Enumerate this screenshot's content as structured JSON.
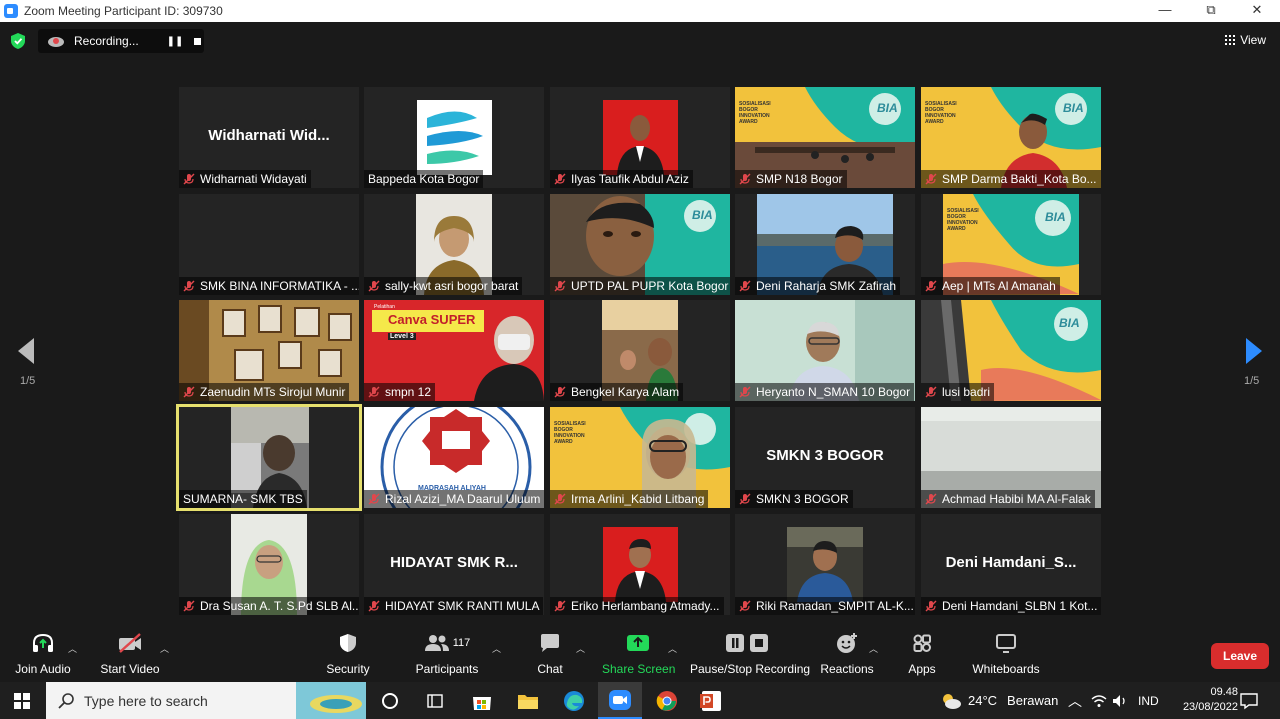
{
  "window": {
    "title": "Zoom Meeting Participant ID: 309730",
    "minimize": "—",
    "restore": "⧉",
    "close": "✕"
  },
  "recording": {
    "label": "Recording...",
    "pause": "❚❚"
  },
  "view": {
    "label": "View"
  },
  "pagination": {
    "left_page": "1/5",
    "right_page": "1/5"
  },
  "tiles": [
    {
      "name": "Widharnati Widayati",
      "display_name": "Widharnati  Wid...",
      "muted": true
    },
    {
      "name": "Bappeda Kota Bogor",
      "muted": false
    },
    {
      "name": "Ilyas Taufik Abdul Aziz",
      "muted": true
    },
    {
      "name": "SMP N18 Bogor",
      "muted": true
    },
    {
      "name": "SMP Darma Bakti_Kota Bo...",
      "muted": true
    },
    {
      "name": "SMK BINA INFORMATIKA - ...",
      "muted": true
    },
    {
      "name": "sally-kwt asri bogor barat",
      "muted": true
    },
    {
      "name": "UPTD PAL PUPR Kota Bogor",
      "muted": true
    },
    {
      "name": "Deni Raharja SMK Zafirah",
      "muted": true
    },
    {
      "name": "Aep | MTs Al Amanah",
      "muted": true
    },
    {
      "name": "Zaenudin MTs Sirojul Munir",
      "muted": true
    },
    {
      "name": "smpn 12",
      "muted": true
    },
    {
      "name": "Bengkel Karya Alam",
      "muted": true
    },
    {
      "name": "Heryanto N_SMAN 10 Bogor",
      "muted": true
    },
    {
      "name": "lusi badri",
      "muted": true
    },
    {
      "name": "SUMARNA- SMK TBS",
      "muted": false
    },
    {
      "name": "Rizal Azizi_MA Daarul Uluum",
      "muted": true
    },
    {
      "name": "Irma Arlini_Kabid Litbang",
      "muted": true
    },
    {
      "name": "SMKN 3 BOGOR",
      "display_name": "SMKN 3 BOGOR",
      "muted": true
    },
    {
      "name": "Achmad Habibi MA Al-Falak",
      "muted": true
    },
    {
      "name": "Dra Susan A. T. S.Pd SLB Al...",
      "muted": true
    },
    {
      "name": "HIDAYAT SMK RANTI MULA",
      "display_name": "HIDAYAT SMK R...",
      "muted": true
    },
    {
      "name": "Eriko Herlambang Atmady...",
      "muted": true
    },
    {
      "name": "Riki Ramadan_SMPIT AL-K...",
      "muted": true
    },
    {
      "name": "Deni Hamdani_SLBN 1 Kot...",
      "display_name": "Deni  Hamdani_S...",
      "muted": true
    }
  ],
  "screen_text": {
    "banner_line1": "SOSIALISASI",
    "banner_line2": "BOGOR",
    "banner_line3": "INNOVATION",
    "banner_line4": "AWARD",
    "bia_logo": "BIA",
    "canva_title": "Canva SUPER",
    "canva_level": "Level 3",
    "canva_top": "Pelatihan",
    "madrasah_label": "MADRASAH ALIYAH"
  },
  "toolbar": {
    "join_audio": "Join Audio",
    "start_video": "Start Video",
    "security": "Security",
    "participants": "Participants",
    "participants_count": "117",
    "chat": "Chat",
    "share_screen": "Share Screen",
    "pause_stop_recording": "Pause/Stop Recording",
    "reactions": "Reactions",
    "apps": "Apps",
    "whiteboards": "Whiteboards",
    "leave": "Leave"
  },
  "taskbar": {
    "search_placeholder": "Type here to search",
    "weather_temp": "24°C",
    "weather_desc": "Berawan",
    "language": "IND",
    "time": "09.48",
    "date": "23/08/2022"
  },
  "colors": {
    "share_green": "#23d959",
    "leave_red": "#d92d2d",
    "active_speaker": "#e6e06e",
    "mic_muted": "#e0474c",
    "nav_blue": "#2d8cff"
  }
}
